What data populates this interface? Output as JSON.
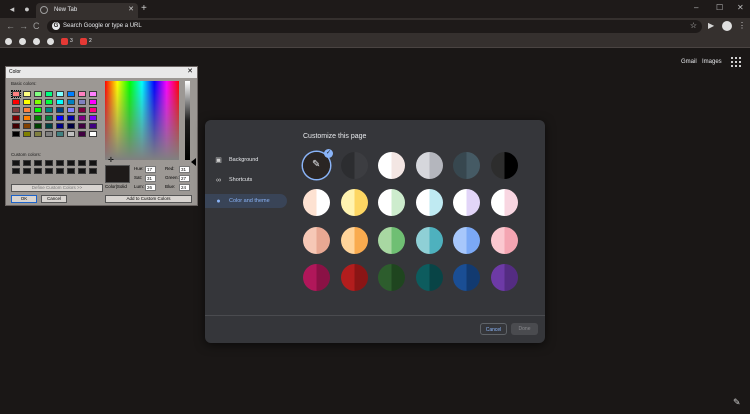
{
  "browser": {
    "tab_title": "New Tab",
    "tab_close": "✕",
    "new_tab": "+",
    "window_controls": {
      "minimize": "–",
      "maximize": "☐",
      "close": "✕"
    },
    "omnibox_placeholder": "Search Google or type a URL",
    "omnibox_g": "G",
    "nav": {
      "back": "←",
      "forward": "→",
      "reload": "C"
    },
    "bookmarks": [
      {
        "label": ""
      },
      {
        "label": ""
      },
      {
        "label": ""
      },
      {
        "label": ""
      },
      {
        "label": "3"
      },
      {
        "label": "2"
      }
    ]
  },
  "google_links": {
    "gmail": "Gmail",
    "images": "Images"
  },
  "color_dialog": {
    "title": "Color",
    "close": "✕",
    "basic_colors_label": "Basic colors:",
    "custom_colors_label": "Custom colors:",
    "define_button": "Define Custom Colors >>",
    "ok_button": "OK",
    "cancel_button": "Cancel",
    "add_button": "Add to Custom Colors",
    "colorsolid_label": "Color|Solid",
    "fields": {
      "hue_label": "Hue:",
      "hue": "17",
      "sat_label": "Sat:",
      "sat": "31",
      "lum_label": "Lum:",
      "lum": "26",
      "red_label": "Red:",
      "red": "31",
      "green_label": "Green:",
      "green": "27",
      "blue_label": "Blue:",
      "blue": "24"
    },
    "basic_colors": [
      "#ff8080",
      "#ffff80",
      "#80ff80",
      "#00ff80",
      "#80ffff",
      "#0080ff",
      "#ff80c0",
      "#ff80ff",
      "#ff0000",
      "#ffff00",
      "#80ff00",
      "#00ff40",
      "#00ffff",
      "#0080c0",
      "#8080c0",
      "#ff00ff",
      "#804040",
      "#ff8040",
      "#00ff00",
      "#008080",
      "#004080",
      "#8080ff",
      "#800040",
      "#ff0080",
      "#800000",
      "#ff8000",
      "#008000",
      "#008040",
      "#0000ff",
      "#0000a0",
      "#800080",
      "#8000ff",
      "#400000",
      "#804000",
      "#004000",
      "#004040",
      "#000080",
      "#000040",
      "#400040",
      "#400080",
      "#000000",
      "#808000",
      "#808040",
      "#808080",
      "#408080",
      "#c0c0c0",
      "#400040",
      "#ffffff"
    ]
  },
  "customize": {
    "title": "Customize this page",
    "nav": [
      {
        "label": "Background",
        "icon": "image-icon"
      },
      {
        "label": "Shortcuts",
        "icon": "link-icon"
      },
      {
        "label": "Color and theme",
        "icon": "palette-icon"
      }
    ],
    "cancel": "Cancel",
    "done": "Done",
    "themes": [
      [
        "#2a2523",
        "#2a2523"
      ],
      [
        "#2c2d30",
        "#3c3d41"
      ],
      [
        "#ffffff",
        "#f3e6e3"
      ],
      [
        "#d6d7dc",
        "#b4b6bd"
      ],
      [
        "#37474f",
        "#455a64"
      ],
      [
        "#2d2d2d",
        "#000000"
      ],
      [
        "#fde2d2",
        "#ffffff"
      ],
      [
        "#fff3b0",
        "#fdd663"
      ],
      [
        "#ffffff",
        "#cdeccd"
      ],
      [
        "#ffffff",
        "#bfeaf2"
      ],
      [
        "#ffffff",
        "#e2d5f8"
      ],
      [
        "#ffffff",
        "#f8d6e1"
      ],
      [
        "#f6c8b6",
        "#e8a893"
      ],
      [
        "#ffd49a",
        "#f9ab4f"
      ],
      [
        "#a8d8a2",
        "#6fbf73"
      ],
      [
        "#8fd0d6",
        "#4eb1be"
      ],
      [
        "#a7c7fb",
        "#7ba9f6"
      ],
      [
        "#fbc8d0",
        "#f4a5b2"
      ],
      [
        "#b0175a",
        "#8a1145"
      ],
      [
        "#b21d1d",
        "#8a1515"
      ],
      [
        "#2d5d2d",
        "#1f451f"
      ],
      [
        "#0d5c5e",
        "#084446"
      ],
      [
        "#1a4e94",
        "#123a70"
      ],
      [
        "#6d3aa6",
        "#542c82"
      ]
    ],
    "check": "✓",
    "pencil": "✎"
  },
  "customize_button": "✎"
}
